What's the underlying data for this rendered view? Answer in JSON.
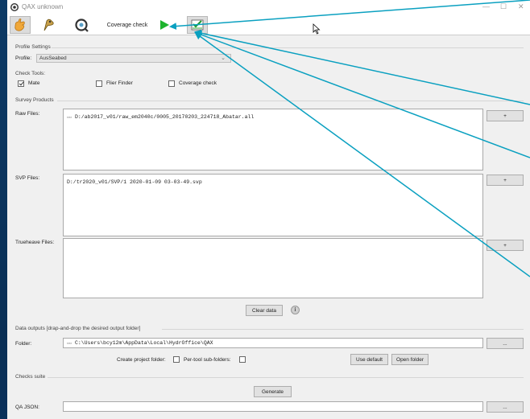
{
  "window": {
    "title": "QAX unknown",
    "minimize": "—",
    "maximize": "☐",
    "close": "✕"
  },
  "toolbar": {
    "coverage_label": "Coverage check"
  },
  "profile_settings": {
    "header": "Profile Settings",
    "profile_label": "Profile:",
    "profile_value": "AusSeabed"
  },
  "check_tools": {
    "header": "Check Tools:",
    "items": [
      {
        "label": "Mate",
        "checked": true
      },
      {
        "label": "Flier Finder",
        "checked": false
      },
      {
        "label": "Coverage check",
        "checked": false
      }
    ]
  },
  "survey_products": {
    "header": "Survey Products",
    "raw_label": "Raw Files:",
    "raw_files": [
      "D:/ab2017_v01/raw_em2040c/0005_20170203_224718_Abatar.all"
    ],
    "svp_label": "SVP Files:",
    "svp_files": [
      "D:/tr2020_v01/SVP/1   2020-01-09   03-03-49.svp"
    ],
    "trueheave_label": "Trueheave Files:",
    "add_label": "+",
    "clear_label": "Clear data",
    "info_glyph": "i"
  },
  "data_outputs": {
    "header": "Data outputs [drap-and-drop the desired output folder]",
    "folder_label": "Folder:",
    "folder_value": "C:\\Users\\bcy12m\\AppData\\Local\\HydrOffice\\QAX",
    "browse_label": "...",
    "create_project_label": "Create project folder:",
    "per_tool_label": "Per-tool sub-folders:",
    "use_default_label": "Use default",
    "open_folder_label": "Open folder"
  },
  "checks_suite": {
    "header": "Checks suite",
    "generate_label": "Generate",
    "qa_json_label": "QA JSON:",
    "qa_json_value": "",
    "browse_label": "..."
  },
  "colors": {
    "annotation_arrow": "#0aa0c0",
    "play_green": "#1db32e"
  }
}
